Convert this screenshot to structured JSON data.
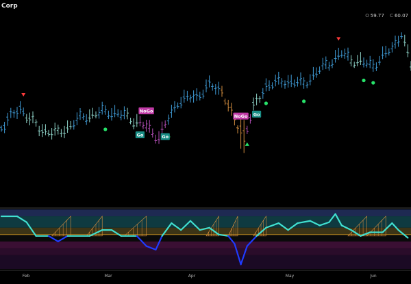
{
  "header": {
    "title": "Corp",
    "quote": [
      {
        "label": "O",
        "value": "59.77"
      },
      {
        "label": "C",
        "value": "60.07"
      }
    ]
  },
  "colors": {
    "strong_up": "#3f9bd6",
    "weak_up": "#8fd4c9",
    "weak_down": "#d08b3e",
    "strong_down": "#b34fb7",
    "go_dot": "#27e36a",
    "arrow_down": "#ff3b3b",
    "arrow_up": "#27e36a",
    "osc_line": "#40e0d0",
    "osc_low": "#1f3bff",
    "hatch": "#e09240"
  },
  "chart_data": {
    "type": "ohlc",
    "x_ticks": [
      "Feb",
      "Mar",
      "Apr",
      "May",
      "Jun"
    ],
    "labels": [
      {
        "text": "NoGo",
        "style": "nogo",
        "at": 46,
        "side": "above"
      },
      {
        "text": "Go",
        "style": "go",
        "at": 44,
        "side": "below"
      },
      {
        "text": "Go",
        "style": "go",
        "at": 52,
        "side": "below"
      },
      {
        "text": "NoGo",
        "style": "nogo",
        "at": 76,
        "side": "above"
      },
      {
        "text": "Go",
        "style": "go",
        "at": 81,
        "side": "below"
      }
    ],
    "dots": [
      33,
      53,
      84,
      96,
      115,
      118
    ],
    "arrows_down": [
      7,
      107
    ],
    "arrows_up": [
      78
    ],
    "oscillator": {
      "series": [
        {
          "x": 0,
          "y": 0.85
        },
        {
          "x": 5,
          "y": 0.85
        },
        {
          "x": 8,
          "y": 0.72
        },
        {
          "x": 11,
          "y": 0.42
        },
        {
          "x": 15,
          "y": 0.42
        },
        {
          "x": 18,
          "y": 0.3
        },
        {
          "x": 21,
          "y": 0.42
        },
        {
          "x": 28,
          "y": 0.42
        },
        {
          "x": 32,
          "y": 0.55
        },
        {
          "x": 35,
          "y": 0.55
        },
        {
          "x": 38,
          "y": 0.42
        },
        {
          "x": 43,
          "y": 0.42
        },
        {
          "x": 46,
          "y": 0.2
        },
        {
          "x": 49,
          "y": 0.12
        },
        {
          "x": 51,
          "y": 0.42
        },
        {
          "x": 54,
          "y": 0.7
        },
        {
          "x": 57,
          "y": 0.55
        },
        {
          "x": 60,
          "y": 0.75
        },
        {
          "x": 63,
          "y": 0.55
        },
        {
          "x": 66,
          "y": 0.6
        },
        {
          "x": 69,
          "y": 0.45
        },
        {
          "x": 72,
          "y": 0.42
        },
        {
          "x": 74,
          "y": 0.25
        },
        {
          "x": 76,
          "y": -0.2
        },
        {
          "x": 78,
          "y": 0.2
        },
        {
          "x": 81,
          "y": 0.42
        },
        {
          "x": 84,
          "y": 0.6
        },
        {
          "x": 88,
          "y": 0.7
        },
        {
          "x": 91,
          "y": 0.55
        },
        {
          "x": 94,
          "y": 0.7
        },
        {
          "x": 98,
          "y": 0.75
        },
        {
          "x": 101,
          "y": 0.65
        },
        {
          "x": 104,
          "y": 0.72
        },
        {
          "x": 106,
          "y": 0.9
        },
        {
          "x": 108,
          "y": 0.65
        },
        {
          "x": 111,
          "y": 0.55
        },
        {
          "x": 114,
          "y": 0.42
        },
        {
          "x": 117,
          "y": 0.5
        },
        {
          "x": 121,
          "y": 0.5
        },
        {
          "x": 124,
          "y": 0.7
        },
        {
          "x": 126,
          "y": 0.55
        },
        {
          "x": 129,
          "y": 0.38
        }
      ]
    }
  }
}
